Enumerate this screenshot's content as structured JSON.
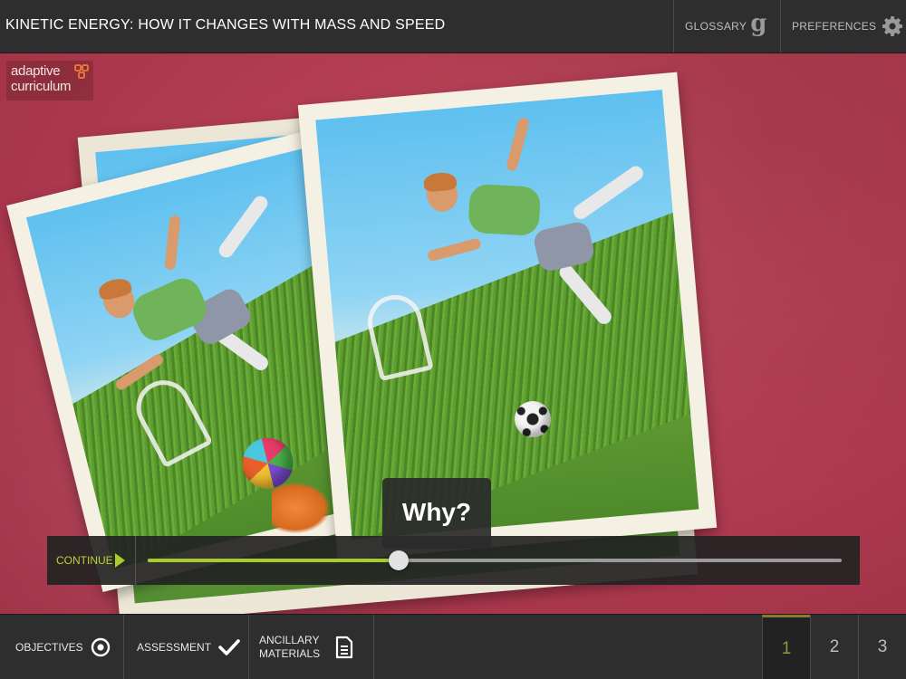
{
  "header": {
    "title": "KINETIC ENERGY: HOW IT CHANGES WITH MASS AND SPEED",
    "glossary_label": "GLOSSARY",
    "glossary_icon": "g-glyph-icon",
    "glossary_glyph": "g",
    "preferences_label": "PREFERENCES",
    "preferences_icon": "gear-icon"
  },
  "logo": {
    "line1": "adaptive",
    "line2": "curriculum",
    "accent_color": "#f07a3a"
  },
  "tooltip": {
    "text": "Why?"
  },
  "scrubber": {
    "continue_label": "CONTINUE",
    "continue_icon": "play-triangle-icon",
    "progress": 0.362,
    "accent_color": "#a8cc2a"
  },
  "footer": {
    "objectives_label": "OBJECTIVES",
    "objectives_icon": "target-icon",
    "assessment_label": "ASSESSMENT",
    "assessment_icon": "checkmark-icon",
    "ancillary_label_line1": "ANCILLARY",
    "ancillary_label_line2": "MATERIALS",
    "ancillary_icon": "document-icon",
    "pages": [
      "1",
      "2",
      "3"
    ],
    "active_page": "1"
  }
}
